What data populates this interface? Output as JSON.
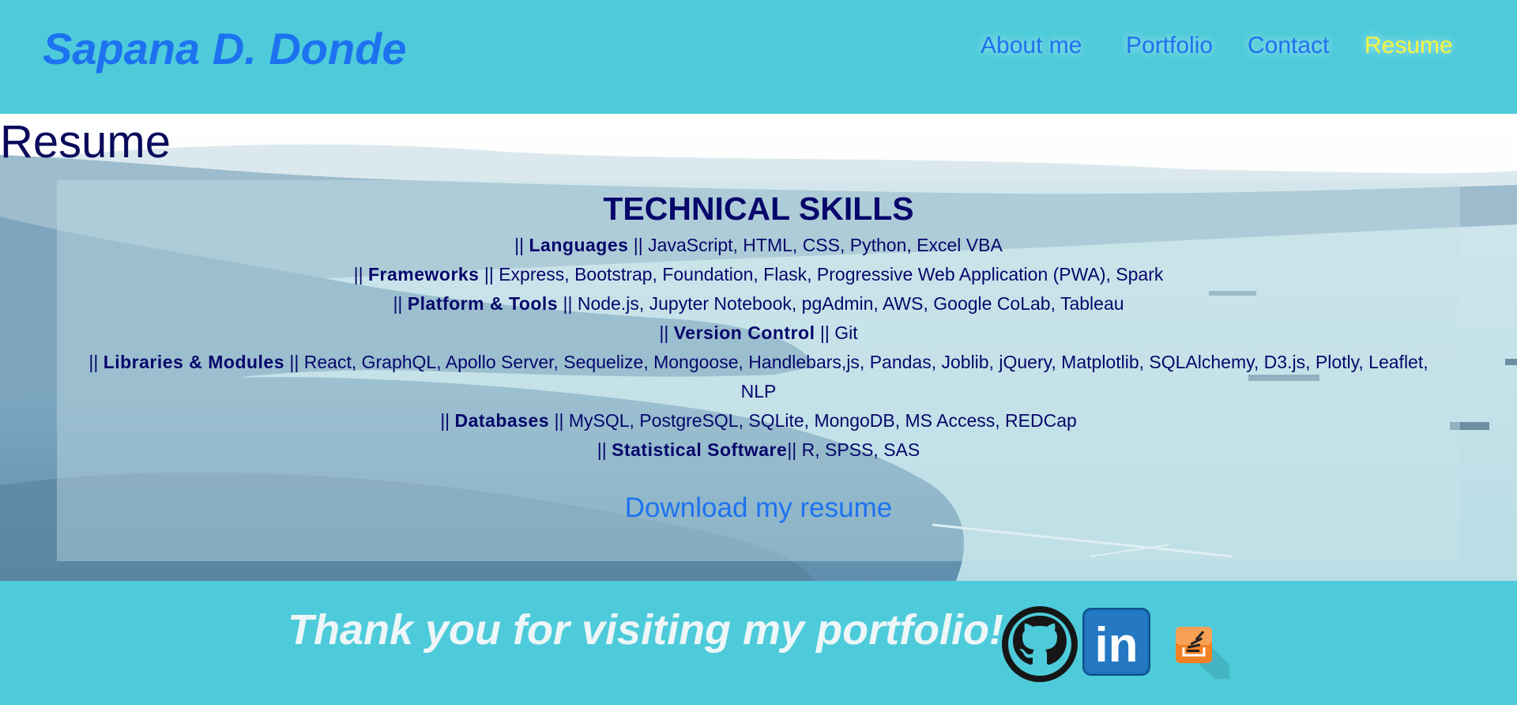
{
  "header": {
    "title": "Sapana D. Donde",
    "nav": [
      {
        "label": "About me",
        "active": false
      },
      {
        "label": "Portfolio",
        "active": false
      },
      {
        "label": "Contact",
        "active": false
      },
      {
        "label": "Resume",
        "active": true
      }
    ]
  },
  "main": {
    "heading": "Resume",
    "skills": {
      "title": "TECHNICAL SKILLS",
      "items": [
        {
          "prefix": "|| ",
          "category": "Languages",
          "separator": " || ",
          "values": "JavaScript, HTML, CSS, Python, Excel VBA"
        },
        {
          "prefix": "|| ",
          "category": "Frameworks",
          "separator": " || ",
          "values": "Express, Bootstrap, Foundation, Flask, Progressive Web Application (PWA), Spark"
        },
        {
          "prefix": "|| ",
          "category": "Platform & Tools",
          "separator": " || ",
          "values": "Node.js, Jupyter Notebook, pgAdmin, AWS, Google CoLab, Tableau"
        },
        {
          "prefix": "|| ",
          "category": "Version Control",
          "separator": " || ",
          "values": "Git"
        },
        {
          "prefix": "|| ",
          "category": "Libraries & Modules",
          "separator": " || ",
          "values": "React, GraphQL, Apollo Server, Sequelize, Mongoose, Handlebars,js, Pandas, Joblib, jQuery, Matplotlib, SQLAlchemy, D3.js, Plotly, Leaflet, NLP"
        },
        {
          "prefix": "|| ",
          "category": "Databases",
          "separator": " || ",
          "values": "MySQL, PostgreSQL, SQLite, MongoDB, MS Access, REDCap"
        },
        {
          "prefix": "|| ",
          "category": "Statistical Software",
          "separator": "|| ",
          "values": "R, SPSS, SAS"
        }
      ]
    },
    "download_label": "Download my resume"
  },
  "footer": {
    "thanks": "Thank you for visiting my portfolio!",
    "social_icons": [
      "github-icon",
      "linkedin-icon",
      "stackoverflow-icon"
    ],
    "linkedin_text": "in"
  },
  "colors": {
    "header_bg": "#4ecbda",
    "link_blue": "#1d72f0",
    "active_nav": "#f4f53f",
    "heading_navy": "#06066b"
  }
}
